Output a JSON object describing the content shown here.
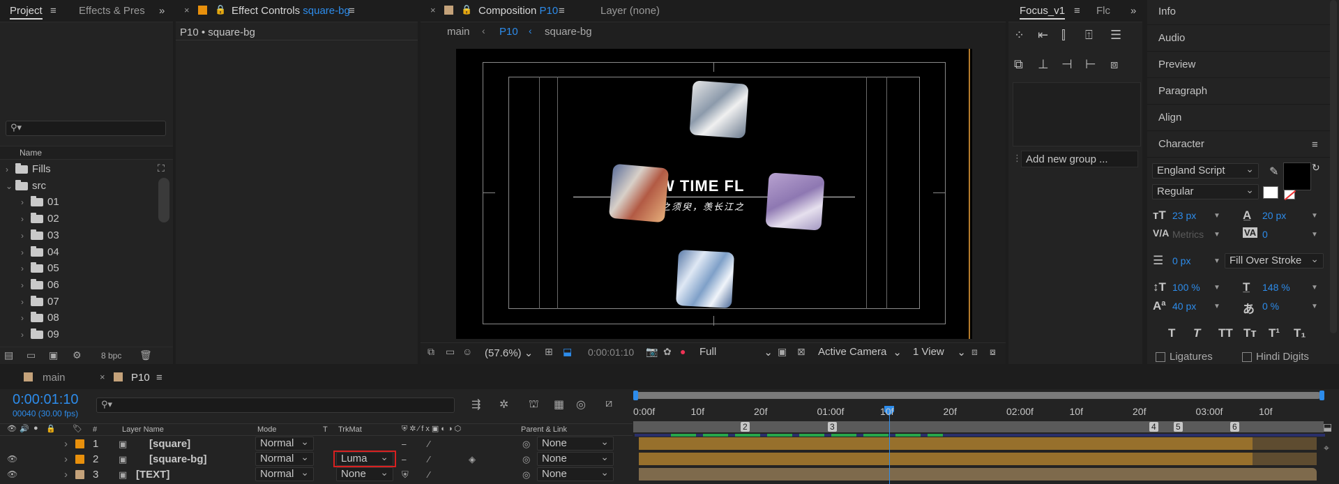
{
  "project_panel": {
    "tab_project": "Project",
    "tab_effects": "Effects & Pres",
    "search_placeholder": "",
    "column_name": "Name",
    "items": [
      {
        "label": "Fills",
        "expanded": false,
        "indent": 0
      },
      {
        "label": "src",
        "expanded": true,
        "indent": 0
      },
      {
        "label": "01",
        "indent": 1
      },
      {
        "label": "02",
        "indent": 1
      },
      {
        "label": "03",
        "indent": 1
      },
      {
        "label": "04",
        "indent": 1
      },
      {
        "label": "05",
        "indent": 1
      },
      {
        "label": "06",
        "indent": 1
      },
      {
        "label": "07",
        "indent": 1
      },
      {
        "label": "08",
        "indent": 1
      },
      {
        "label": "09",
        "indent": 1
      }
    ],
    "bpc": "8 bpc"
  },
  "effect_controls": {
    "tab_label": "Effect Controls",
    "tab_target": "square-bg",
    "subtitle": "P10 • square-bg"
  },
  "composition": {
    "tab_label": "Composition",
    "tab_name": "P10",
    "layer_tab": "Layer (none)",
    "crumbs": [
      "main",
      "P10",
      "square-bg"
    ],
    "title_text": "W TIME FL",
    "subtitle_text": "之须臾，羡长江之",
    "zoom": "(57.6%)",
    "timecode": "0:00:01:10",
    "resolution": "Full",
    "camera": "Active Camera",
    "views": "1 View"
  },
  "focus_panel": {
    "tab_label": "Focus_v1",
    "tab_flc": "Flc",
    "add_group": "Add new group ..."
  },
  "right_panel": {
    "items": [
      "Info",
      "Audio",
      "Preview",
      "Paragraph",
      "Align",
      "Character"
    ],
    "font_family": "England Script",
    "font_style": "Regular",
    "font_size": "23 px",
    "leading": "20 px",
    "kerning": "Metrics",
    "tracking": "0",
    "stroke_width": "0 px",
    "stroke_type": "Fill Over Stroke",
    "vscale": "100 %",
    "hscale": "148 %",
    "baseline": "40 px",
    "tsume": "0 %",
    "style_buttons": [
      "T",
      "T",
      "TT",
      "Tт",
      "T¹",
      "T₁"
    ],
    "ligatures": "Ligatures",
    "hindi_digits": "Hindi Digits"
  },
  "timeline": {
    "tab_main": "main",
    "tab_p10": "P10",
    "timecode": "0:00:01:10",
    "frame_info": "00040 (30.00 fps)",
    "col_number": "#",
    "col_layer_name": "Layer Name",
    "col_mode": "Mode",
    "col_t": "T",
    "col_trkmat": "TrkMat",
    "col_parent": "Parent & Link",
    "ruler": [
      "0:00f",
      "10f",
      "20f",
      "01:00f",
      "10f",
      "20f",
      "02:00f",
      "10f",
      "20f",
      "03:00f",
      "10f"
    ],
    "markers": [
      "2",
      "3",
      "4",
      "5",
      "6"
    ],
    "layers": [
      {
        "num": "1",
        "name": "[square]",
        "mode": "Normal",
        "trkmat": "",
        "parent": "None",
        "color": "#e8900c"
      },
      {
        "num": "2",
        "name": "[square-bg]",
        "mode": "Normal",
        "trkmat": "Luma",
        "parent": "None",
        "color": "#e8900c"
      },
      {
        "num": "3",
        "name": "[TEXT]",
        "mode": "Normal",
        "trkmat": "None",
        "parent": "None",
        "color": "#c4a27a"
      }
    ]
  }
}
